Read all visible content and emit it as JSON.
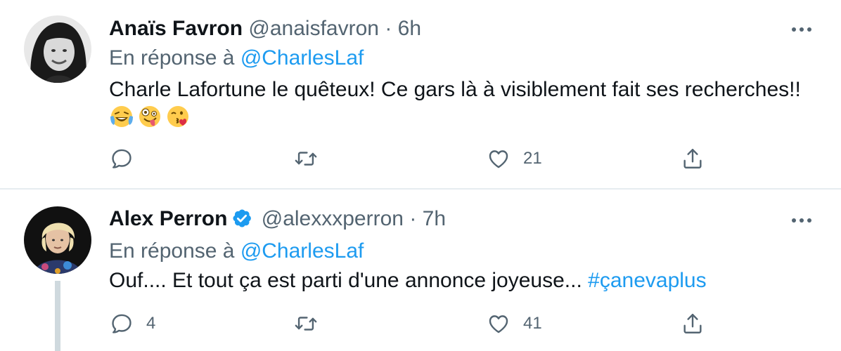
{
  "tweets": [
    {
      "author_name": "Anaïs Favron",
      "author_handle": "@anaisfavron",
      "separator": "·",
      "time": "6h",
      "verified": false,
      "reply_prefix": "En réponse à",
      "reply_to": "@CharlesLaf",
      "text": "Charle Lafortune le quêteux! Ce gars là à visiblement fait ses recherches!!",
      "emojis": [
        "face-with-tears-of-joy",
        "zany-face",
        "face-blowing-a-kiss"
      ],
      "replies": "",
      "retweets": "",
      "likes": "21"
    },
    {
      "author_name": "Alex Perron",
      "author_handle": "@alexxxperron",
      "separator": "·",
      "time": "7h",
      "verified": true,
      "reply_prefix": "En réponse à",
      "reply_to": "@CharlesLaf",
      "text": "Ouf.... Et tout ça est parti d'une annonce joyeuse...",
      "hashtag": "#çanevaplus",
      "replies": "4",
      "retweets": "",
      "likes": "41"
    }
  ],
  "icons": {
    "reply": "reply-icon",
    "retweet": "retweet-icon",
    "like": "heart-icon",
    "share": "share-icon",
    "more": "more-icon",
    "verified": "verified-badge-icon"
  },
  "colors": {
    "link": "#1d9bf0",
    "secondary_text": "#536471",
    "primary_text": "#0f1419",
    "divider": "#e6ecf0",
    "thread_line": "#cfd9de"
  }
}
